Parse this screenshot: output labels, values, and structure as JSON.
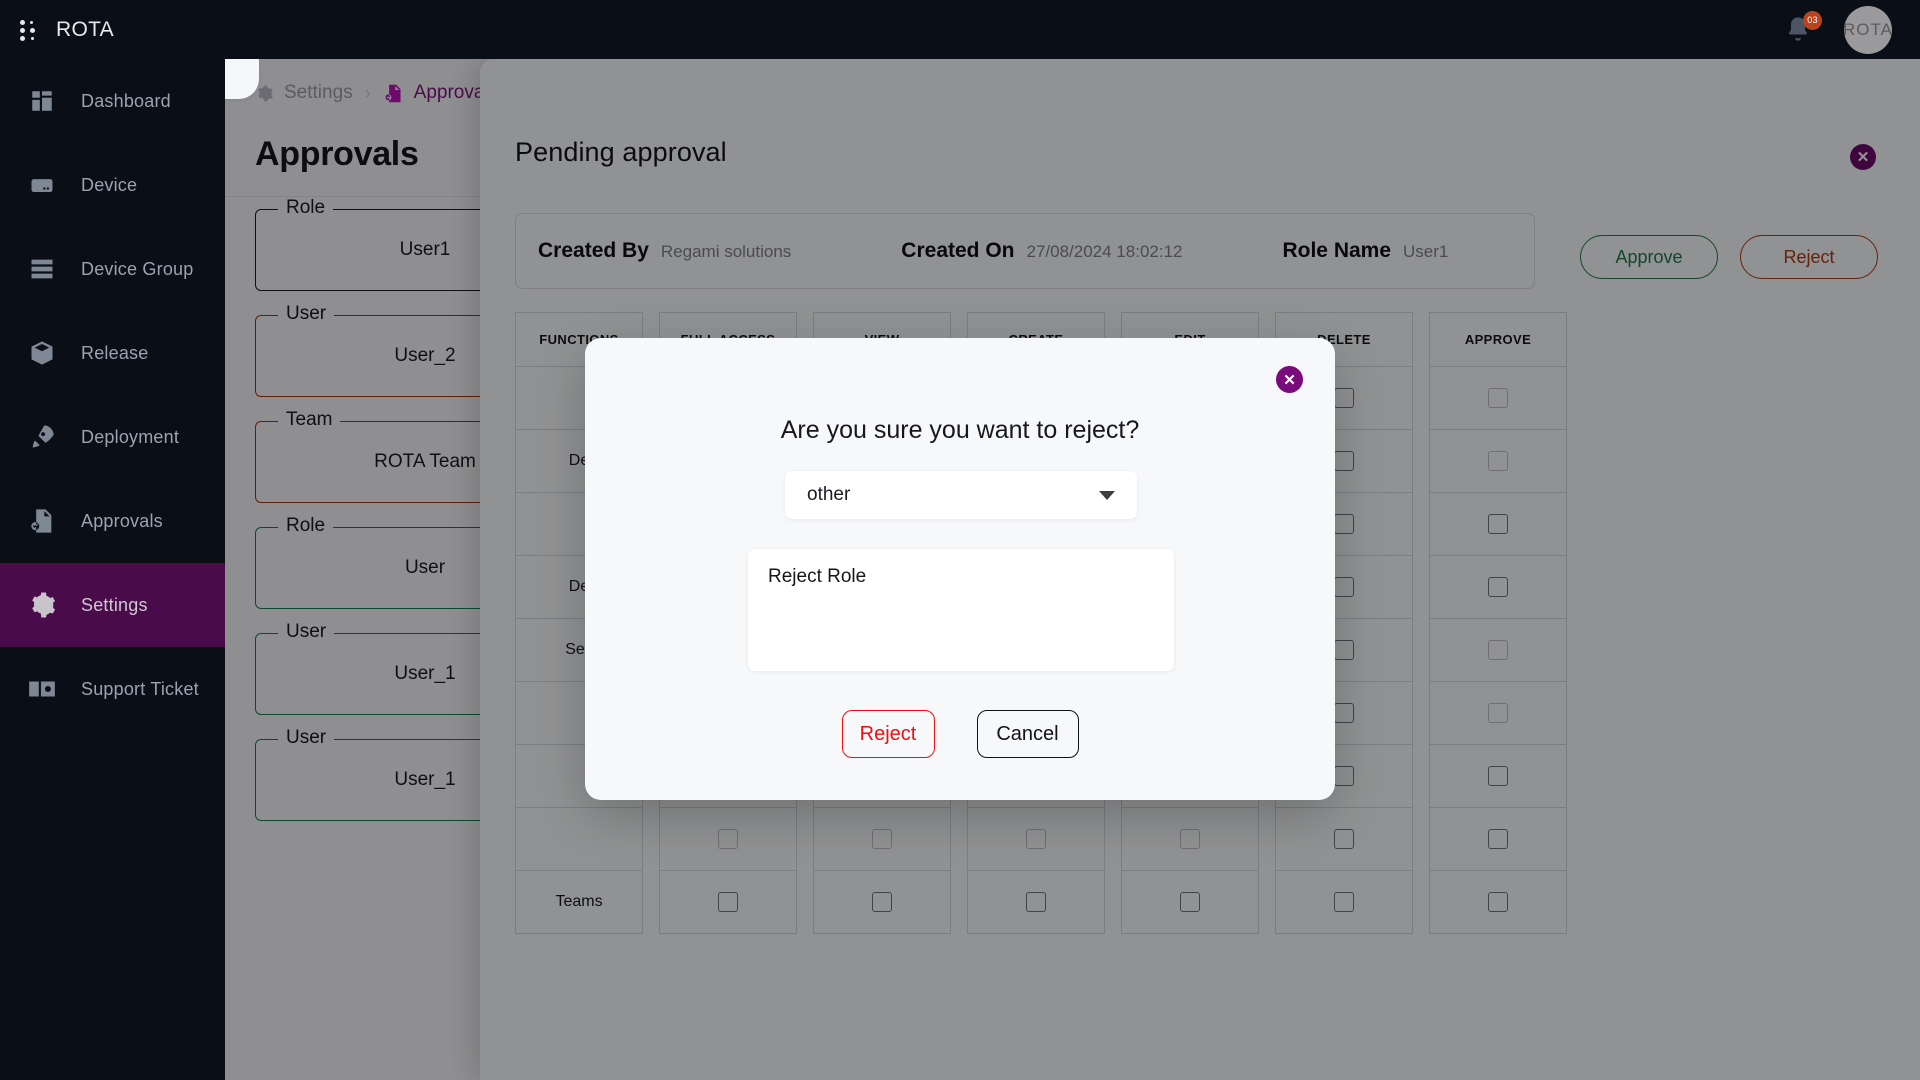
{
  "topbar": {
    "brand": "ROTA",
    "logo_icon": "dots-grid-icon",
    "notification_icon": "bell-icon",
    "notification_count": "03",
    "avatar_label": "ROTA"
  },
  "sidebar": {
    "items": [
      {
        "label": "Dashboard",
        "icon": "dashboard-icon",
        "active": false
      },
      {
        "label": "Device",
        "icon": "device-icon",
        "active": false
      },
      {
        "label": "Device Group",
        "icon": "device-group-icon",
        "active": false
      },
      {
        "label": "Release",
        "icon": "box-icon",
        "active": false
      },
      {
        "label": "Deployment",
        "icon": "rocket-icon",
        "active": false
      },
      {
        "label": "Approvals",
        "icon": "approvals-icon",
        "active": false
      },
      {
        "label": "Settings",
        "icon": "gear-icon",
        "active": true
      },
      {
        "label": "Support Ticket",
        "icon": "ticket-gear-icon",
        "active": false
      }
    ]
  },
  "breadcrumb": {
    "collapse_icon": "chevron-left-icon",
    "settings_icon": "gear-icon",
    "settings_label": "Settings",
    "separator": "›",
    "current_icon": "approvals-icon",
    "current_label": "Approvals"
  },
  "page": {
    "title": "Approvals"
  },
  "approval_cards": [
    {
      "legend": "Role",
      "value": "User1",
      "color": "black"
    },
    {
      "legend": "User",
      "value": "User_2",
      "color": "red"
    },
    {
      "legend": "Team",
      "value": "ROTA Team",
      "color": "red"
    },
    {
      "legend": "Role",
      "value": "User",
      "color": "green"
    },
    {
      "legend": "User",
      "value": "User_1",
      "color": "green"
    },
    {
      "legend": "User",
      "value": "User_1",
      "color": "green"
    }
  ],
  "panel": {
    "title": "Pending approval",
    "close_icon": "close-icon",
    "meta": [
      {
        "key": "Created By",
        "value": "Regami solutions"
      },
      {
        "key": "Created On",
        "value": "27/08/2024 18:02:12"
      },
      {
        "key": "Role Name",
        "value": "User1"
      }
    ],
    "approve_label": "Approve",
    "reject_label": "Reject",
    "table": {
      "columns": [
        "FUNCTIONS",
        "FULL ACCESS",
        "VIEW",
        "CREATE",
        "EDIT",
        "DELETE",
        "APPROVE"
      ],
      "rows": [
        {
          "function": "",
          "checks": [
            "dim",
            "dim",
            "dim",
            "dim",
            "on",
            "dim"
          ]
        },
        {
          "function": "De",
          "checks": [
            "dim",
            "dim",
            "dim",
            "dim",
            "on",
            "dim"
          ]
        },
        {
          "function": "",
          "checks": [
            "dim",
            "dim",
            "dim",
            "dim",
            "on",
            "on"
          ]
        },
        {
          "function": "De",
          "checks": [
            "dim",
            "dim",
            "dim",
            "dim",
            "on",
            "on"
          ]
        },
        {
          "function": "Sec",
          "checks": [
            "dim",
            "dim",
            "dim",
            "dim",
            "on",
            "dim"
          ]
        },
        {
          "function": "",
          "checks": [
            "dim",
            "dim",
            "dim",
            "dim",
            "on",
            "dim"
          ]
        },
        {
          "function": "",
          "checks": [
            "dim",
            "dim",
            "dim",
            "dim",
            "on",
            "on"
          ]
        },
        {
          "function": "",
          "checks": [
            "dim",
            "dim",
            "dim",
            "dim",
            "on",
            "on"
          ]
        },
        {
          "function": "Teams",
          "checks": [
            "on",
            "on",
            "on",
            "on",
            "on",
            "on"
          ]
        }
      ]
    }
  },
  "confirm_modal": {
    "close_icon": "close-icon",
    "question": "Are you sure you want to reject?",
    "select_value": "other",
    "select_caret_icon": "chevron-down-icon",
    "reason_value": "Reject Role",
    "reject_label": "Reject",
    "cancel_label": "Cancel"
  },
  "colors": {
    "brand_purple": "#4a0b4a",
    "modal_close_purple": "#7a0b7a",
    "reject_red": "#f00d0d",
    "approve_green": "#1f7a4d",
    "panel_reject": "#b03a16",
    "sidebar_bg": "#0a0e17",
    "badge_red": "#b8431f"
  }
}
